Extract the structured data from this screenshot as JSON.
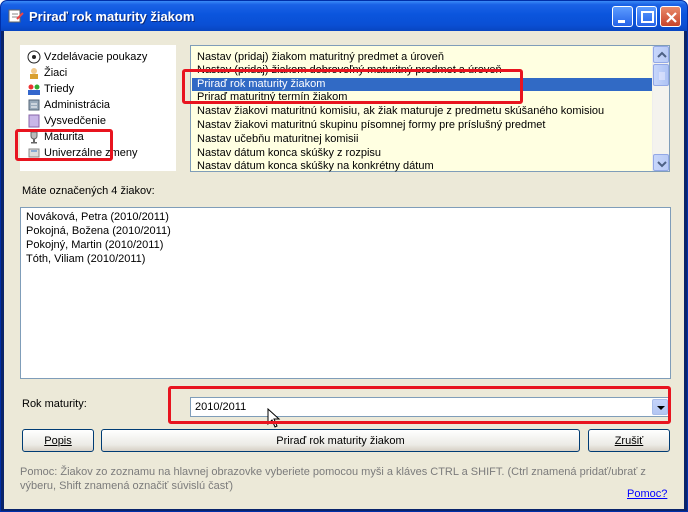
{
  "window": {
    "title": "Priraď rok maturity žiakom"
  },
  "tree": {
    "items": [
      {
        "label": "Vzdelávacie poukazy",
        "icon": "soccer-ball-icon"
      },
      {
        "label": "Žiaci",
        "icon": "students-icon"
      },
      {
        "label": "Triedy",
        "icon": "classes-icon"
      },
      {
        "label": "Administrácia",
        "icon": "admin-icon"
      },
      {
        "label": "Vysvedčenie",
        "icon": "certificate-icon"
      },
      {
        "label": "Maturita",
        "icon": "trophy-icon"
      },
      {
        "label": "Univerzálne zmeny",
        "icon": "universal-icon"
      }
    ]
  },
  "actions": {
    "items": [
      "Nastav (pridaj) žiakom maturitný predmet a úroveň",
      "Nastav (pridaj) žiakom dobrovoľný maturitný predmet a úroveň",
      "Priraď rok maturity žiakom",
      "Priraď maturitný termín žiakom",
      "Nastav žiakovi maturitnú komisiu, ak žiak maturuje z predmetu skúšaného komisiou",
      "Nastav žiakovi maturitnú skupinu písomnej formy pre príslušný predmet",
      "Nastav učebňu maturitnej komisii",
      "Nastav dátum konca skúšky z rozpisu",
      "Nastav dátum konca skúšky na konkrétny dátum"
    ],
    "selected_index": 2
  },
  "selection": {
    "label": "Máte označených 4 žiakov:",
    "students": [
      "Nováková, Petra (2010/2011)",
      "Pokojná, Božena (2010/2011)",
      "Pokojný, Martin (2010/2011)",
      "Tóth, Viliam (2010/2011)"
    ]
  },
  "form": {
    "year_label": "Rok maturity:",
    "year_value": "2010/2011"
  },
  "buttons": {
    "describe": "Popis",
    "apply": "Priraď rok maturity žiakom",
    "cancel": "Zrušiť"
  },
  "help": {
    "text": "Pomoc: Žiakov zo zoznamu na hlavnej obrazovke vyberiete pomocou myši a kláves CTRL a SHIFT. (Ctrl znamená pridať/ubrať z výberu, Shift znamená označiť súvislú časť)",
    "link": "Pomoc?"
  },
  "colors": {
    "titlebar": "#0b55dd",
    "selection": "#316ac5",
    "highlight_box": "#e8141f",
    "actions_bg": "#ffffe1"
  }
}
